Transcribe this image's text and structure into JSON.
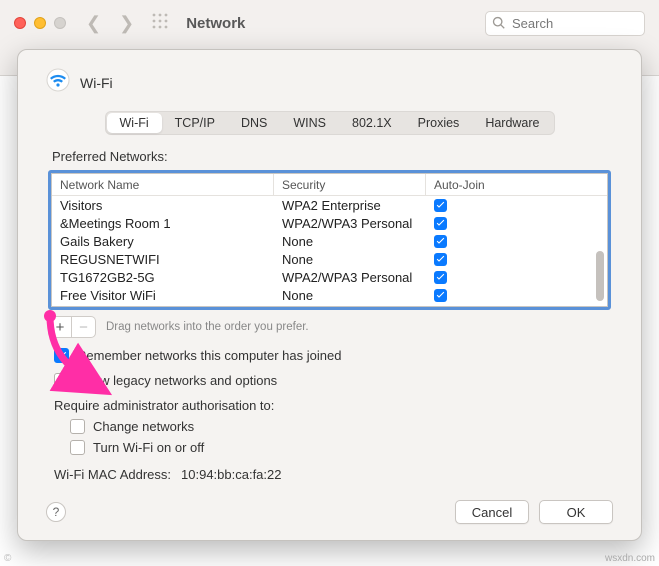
{
  "parent_window": {
    "title": "Network",
    "search_placeholder": "Search"
  },
  "sheet": {
    "title": "Wi-Fi",
    "tabs": [
      "Wi-Fi",
      "TCP/IP",
      "DNS",
      "WINS",
      "802.1X",
      "Proxies",
      "Hardware"
    ],
    "active_tab_index": 0,
    "preferred_label": "Preferred Networks:",
    "columns": {
      "name": "Network Name",
      "security": "Security",
      "autojoin": "Auto-Join"
    },
    "networks": [
      {
        "name": "Visitors",
        "security": "WPA2 Enterprise",
        "autojoin": true
      },
      {
        "name": "&Meetings Room 1",
        "security": "WPA2/WPA3 Personal",
        "autojoin": true
      },
      {
        "name": "Gails Bakery",
        "security": "None",
        "autojoin": true
      },
      {
        "name": "REGUSNETWIFI",
        "security": "None",
        "autojoin": true
      },
      {
        "name": "TG1672GB2-5G",
        "security": "WPA2/WPA3 Personal",
        "autojoin": true
      },
      {
        "name": "Free Visitor WiFi",
        "security": "None",
        "autojoin": true
      }
    ],
    "drag_hint": "Drag networks into the order you prefer.",
    "remember_label": "Remember networks this computer has joined",
    "remember_checked": true,
    "legacy_label": "Show legacy networks and options",
    "legacy_checked": false,
    "require_auth_label": "Require administrator authorisation to:",
    "change_networks_label": "Change networks",
    "change_networks_checked": false,
    "turn_wifi_label": "Turn Wi-Fi on or off",
    "turn_wifi_checked": false,
    "mac_label": "Wi-Fi MAC Address:",
    "mac_value": "10:94:bb:ca:fa:22",
    "cancel": "Cancel",
    "ok": "OK",
    "help": "?"
  },
  "watermark": "wsxdn.com",
  "copyright": "©"
}
